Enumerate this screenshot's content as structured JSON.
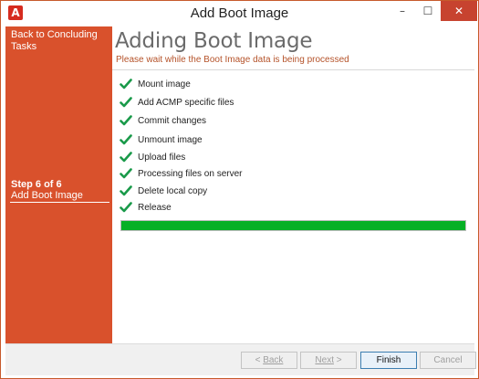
{
  "window": {
    "title": "Add Boot Image",
    "app_icon": "acmp-logo",
    "controls": {
      "minimize": "–",
      "maximize": "☐",
      "close": "✕"
    }
  },
  "sidebar": {
    "back_link": "Back to Concluding Tasks",
    "step_count": "Step 6 of 6",
    "step_name": "Add Boot Image"
  },
  "content": {
    "title": "Adding Boot Image",
    "subtitle": "Please wait while the Boot Image data is being processed",
    "tasks": [
      {
        "label": "Mount image",
        "status": "done",
        "icon": "check-icon"
      },
      {
        "label": "Add ACMP specific files",
        "status": "done",
        "icon": "check-icon"
      },
      {
        "label": "Commit changes",
        "status": "done",
        "icon": "check-icon"
      },
      {
        "label": "Unmount image",
        "status": "done",
        "icon": "check-icon"
      },
      {
        "label": "Upload files",
        "status": "done",
        "icon": "check-icon"
      },
      {
        "label": "Processing files on server",
        "status": "done",
        "icon": "check-icon"
      },
      {
        "label": "Delete local copy",
        "status": "done",
        "icon": "check-icon"
      },
      {
        "label": "Release",
        "status": "done",
        "icon": "check-icon"
      }
    ],
    "progress_percent": 100
  },
  "footer": {
    "back_label": "Back",
    "next_label": "Next",
    "finish_label": "Finish",
    "cancel_label": "Cancel"
  },
  "colors": {
    "accent": "#d9512c",
    "progress": "#06b025",
    "check": "#1a9a4a"
  }
}
